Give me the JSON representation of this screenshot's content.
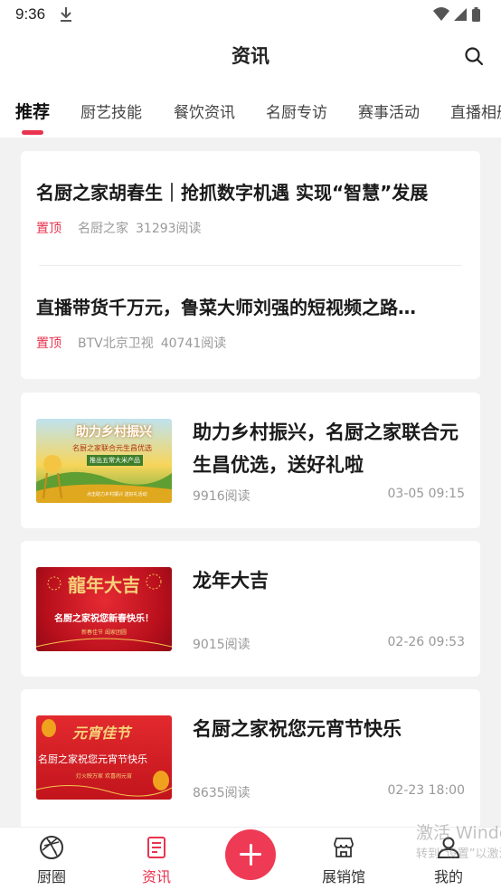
{
  "status_bar": {
    "time": "9:36",
    "icons": [
      "download-icon",
      "wifi-icon",
      "signal-icon",
      "battery-icon"
    ]
  },
  "header": {
    "title": "资讯",
    "search_icon": "search-icon"
  },
  "tabs": [
    {
      "label": "推荐",
      "active": true
    },
    {
      "label": "厨艺技能",
      "active": false
    },
    {
      "label": "餐饮资讯",
      "active": false
    },
    {
      "label": "名厨专访",
      "active": false
    },
    {
      "label": "赛事活动",
      "active": false
    },
    {
      "label": "直播相册",
      "active": false
    }
  ],
  "pinned": [
    {
      "title": "名厨之家胡春生｜抢抓数字机遇 实现“智慧”发展",
      "tag": "置顶",
      "source": "名厨之家",
      "reads": "31293阅读"
    },
    {
      "title": "直播带货千万元，鲁菜大师刘强的短视频之路…",
      "tag": "置顶",
      "source": "BTV北京卫视",
      "reads": "40741阅读"
    }
  ],
  "news": [
    {
      "title": "助力乡村振兴，名厨之家联合元生昌优选，送好礼啦",
      "reads": "9916阅读",
      "time": "03-05 09:15",
      "thumb": {
        "line1": "助力乡村振兴",
        "line2": "名厨之家联合元生昌优选",
        "line3": "推出五常大米产品",
        "line4": "点击助力乡村振兴 送好礼活动",
        "accent": "#f2b21c"
      }
    },
    {
      "title": "龙年大吉",
      "reads": "9015阅读",
      "time": "02-26 09:53",
      "thumb": {
        "line1": "龍年大吉",
        "line2": "名厨之家祝您新春快乐！",
        "line3": "新春佳节 阖家团圆",
        "accent": "#c81424"
      }
    },
    {
      "title": "名厨之家祝您元宵节快乐",
      "reads": "8635阅读",
      "time": "02-23 18:00",
      "thumb": {
        "line1": "元宵佳节",
        "line2": "名厨之家祝您元宵节快乐",
        "line3": "灯火映万家 欢喜闹元宵",
        "accent": "#d81f26"
      }
    }
  ],
  "bottom_nav": [
    {
      "label": "厨圈",
      "icon": "aperture-icon",
      "active": false
    },
    {
      "label": "资讯",
      "icon": "news-icon",
      "active": true
    },
    {
      "label": "展销馆",
      "icon": "store-icon",
      "active": false
    },
    {
      "label": "我的",
      "icon": "user-icon",
      "active": false
    }
  ],
  "fab_icon": "plus-icon",
  "watermark": {
    "line1": "激活 Windows",
    "line2": "转到“设置”以激活 Windows。"
  },
  "colors": {
    "accent": "#e8344e",
    "background": "#f2f2f2",
    "card": "#ffffff",
    "meta_text": "#999999"
  }
}
